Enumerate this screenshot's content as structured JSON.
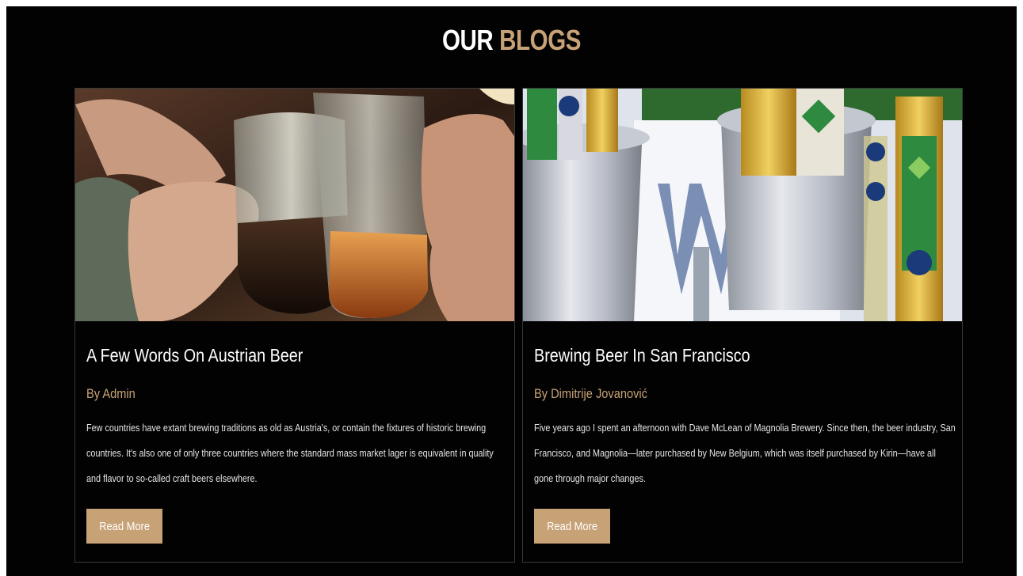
{
  "section": {
    "title_part1": "OUR",
    "title_part2": "BLOGS"
  },
  "posts": [
    {
      "image_desc": "beer-mugs-toast-image",
      "title": "A Few Words On Austrian Beer",
      "author": "By Admin",
      "excerpt": "Few countries have extant brewing traditions as old as Austria's, or contain the fixtures of historic brewing countries. It's also one of only three countries where the standard mass market lager is equivalent in quality and flavor to so-called craft beers elsewhere.",
      "button_label": "Read More"
    },
    {
      "image_desc": "beer-bottles-ice-bucket-image",
      "title": "Brewing Beer In San Francisco",
      "author": "By Dimitrije Jovanović",
      "excerpt": "Five years ago I spent an afternoon with Dave McLean of Magnolia Brewery. Since then, the beer industry, San Francisco, and Magnolia—later purchased by New Belgium, which was itself purchased by Kirin—have all gone through major changes.",
      "button_label": "Read More"
    }
  ],
  "colors": {
    "background": "#020202",
    "accent": "#c8a277",
    "text": "#ffffff"
  }
}
